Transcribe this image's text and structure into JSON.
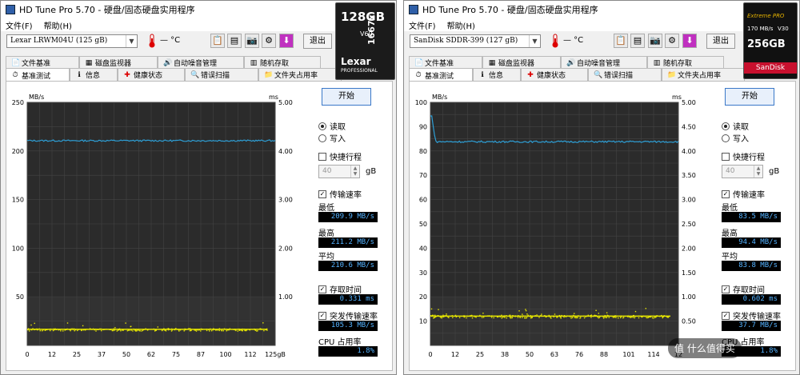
{
  "windows": [
    {
      "title": "HD Tune Pro 5.70 - 硬盘/固态硬盘实用程序",
      "menu": [
        "文件(F)",
        "帮助(H)"
      ],
      "drive": "Lexar   LRWM04U (125 gB)",
      "temperature": "— °C",
      "exit_label": "退出",
      "tabs_row1": [
        "文件基准",
        "磁盘监视器",
        "自动噪音管理",
        "随机存取"
      ],
      "tabs_row2": [
        "基准测试",
        "信息",
        "健康状态",
        "错误扫描",
        "文件夹占用率"
      ],
      "start_label": "开始",
      "read_label": "读取",
      "write_label": "写入",
      "short_stroke_label": "快捷行程",
      "short_stroke_value": "40",
      "short_stroke_unit": "gB",
      "transfer_rate_label": "传输速率",
      "min_label": "最低",
      "min_value": "209.9 MB/s",
      "max_label": "最高",
      "max_value": "211.2 MB/s",
      "avg_label": "平均",
      "avg_value": "210.6 MB/s",
      "access_time_label": "存取时间",
      "access_time_value": "0.331 ms",
      "burst_rate_label": "突发传输速率",
      "burst_rate_value": "105.3 MB/s",
      "cpu_label": "CPU 占用率",
      "cpu_value": "1.8%",
      "overlay": {
        "capacity": "128GB",
        "brand": "Lexar",
        "sub": "PROFESSIONAL",
        "speed": "1667x",
        "vclass": "V60"
      }
    },
    {
      "title": "HD Tune Pro 5.70 - 硬盘/固态硬盘实用程序",
      "menu": [
        "文件(F)",
        "帮助(H)"
      ],
      "drive": "SanDisk SDDR-399 (127 gB)",
      "temperature": "— °C",
      "exit_label": "退出",
      "tabs_row1": [
        "文件基准",
        "磁盘监视器",
        "自动噪音管理",
        "随机存取"
      ],
      "tabs_row2": [
        "基准测试",
        "信息",
        "健康状态",
        "错误扫描",
        "文件夹占用率"
      ],
      "start_label": "开始",
      "read_label": "读取",
      "write_label": "写入",
      "short_stroke_label": "快捷行程",
      "short_stroke_value": "40",
      "short_stroke_unit": "gB",
      "transfer_rate_label": "传输速率",
      "min_label": "最低",
      "min_value": "83.5 MB/s",
      "max_label": "最高",
      "max_value": "94.4 MB/s",
      "avg_label": "平均",
      "avg_value": "83.8 MB/s",
      "access_time_label": "存取时间",
      "access_time_value": "0.602 ms",
      "burst_rate_label": "突发传输速率",
      "burst_rate_value": "37.7 MB/s",
      "cpu_label": "CPU 占用率",
      "cpu_value": "1.8%",
      "overlay": {
        "capacity": "256GB",
        "brand": "SanDisk",
        "sub": "Extreme PRO",
        "speed": "170 MB/s",
        "vclass": "V30"
      },
      "watermark": "值 什么值得买"
    }
  ],
  "chart_data": [
    {
      "type": "line",
      "title": "",
      "left_unit": "MB/s",
      "right_unit": "ms",
      "ylim": [
        0,
        250
      ],
      "y_ticks": [
        50,
        100,
        150,
        200,
        250
      ],
      "y2lim": [
        0,
        5
      ],
      "y2_ticks": [
        "1.00",
        "2.00",
        "3.00",
        "4.00",
        "5.00"
      ],
      "x_ticks": [
        "0",
        "12",
        "25",
        "37",
        "50",
        "62",
        "75",
        "87",
        "100",
        "112",
        "125gB"
      ],
      "xlim": [
        0,
        125
      ],
      "series": [
        {
          "name": "传输速率",
          "color": "#2e9fd6",
          "x": [
            0,
            125
          ],
          "y": [
            210.6,
            210.6
          ],
          "noise": 0.8,
          "start_peak": null
        },
        {
          "name": "存取时间",
          "color": "#e6e600",
          "scatter_level_ms": 0.331,
          "scatter_spread_ms": 0.05
        }
      ]
    },
    {
      "type": "line",
      "title": "",
      "left_unit": "MB/s",
      "right_unit": "ms",
      "ylim": [
        0,
        100
      ],
      "y_ticks": [
        10,
        20,
        30,
        40,
        50,
        60,
        70,
        80,
        90,
        100
      ],
      "y2lim": [
        0,
        5
      ],
      "y2_ticks": [
        "0.50",
        "1.00",
        "1.50",
        "2.00",
        "2.50",
        "3.00",
        "3.50",
        "4.00",
        "4.50",
        "5.00"
      ],
      "x_ticks": [
        "0",
        "12",
        "25",
        "38",
        "50",
        "63",
        "76",
        "88",
        "101",
        "114",
        "12"
      ],
      "xlim": [
        0,
        127
      ],
      "series": [
        {
          "name": "传输速率",
          "color": "#2e9fd6",
          "x": [
            0,
            127
          ],
          "y": [
            83.8,
            83.8
          ],
          "noise": 0.35,
          "start_peak": 94.4
        },
        {
          "name": "存取时间",
          "color": "#e6e600",
          "scatter_level_ms": 0.602,
          "scatter_spread_ms": 0.06
        }
      ]
    }
  ]
}
